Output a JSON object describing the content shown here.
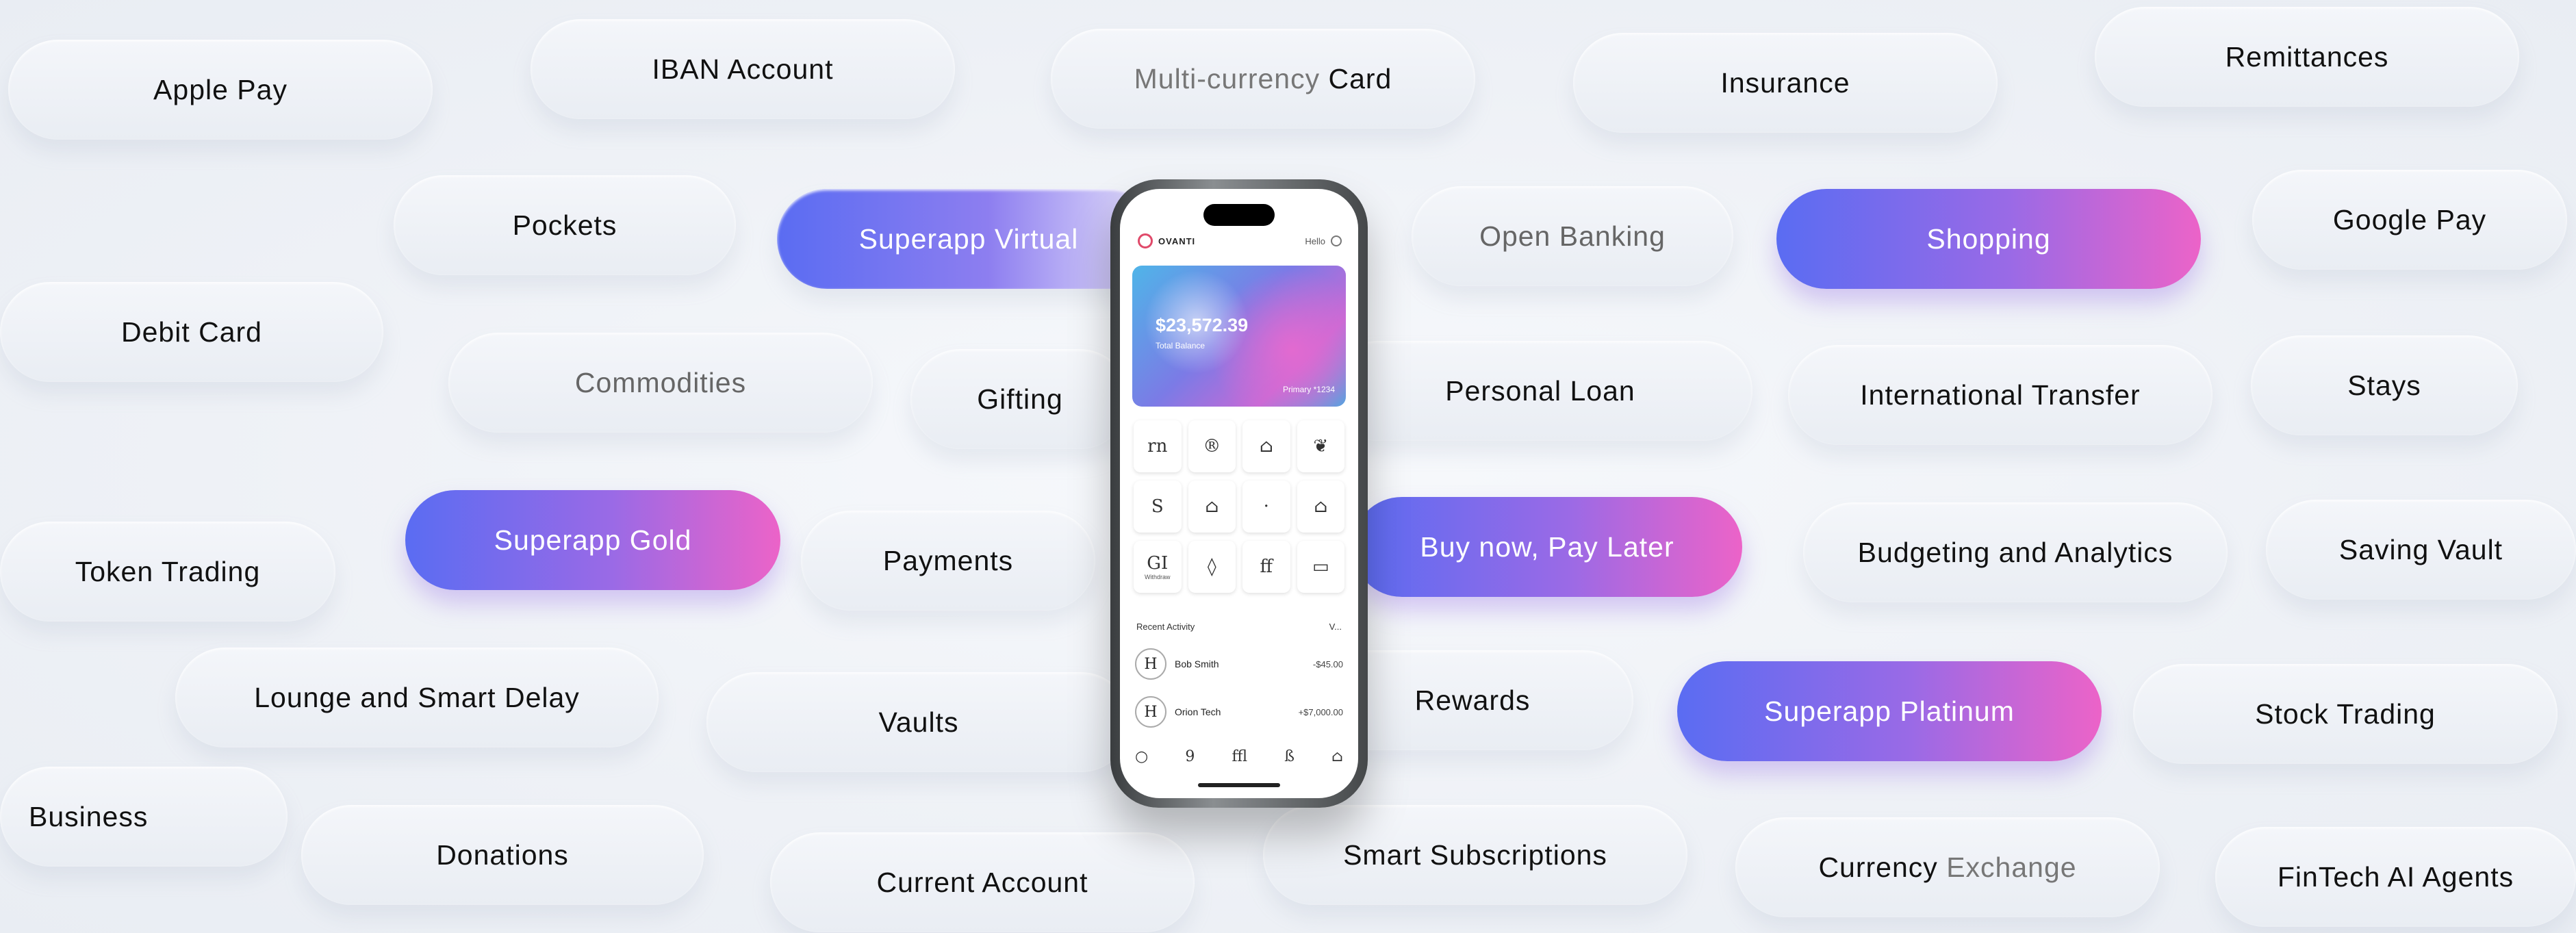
{
  "pills": [
    {
      "label": "Apple Pay"
    },
    {
      "label": "IBAN Account"
    },
    {
      "label_dim": "Multi-currency",
      "label": "Card"
    },
    {
      "label": "Insurance"
    },
    {
      "label": "Remittances"
    },
    {
      "label": "Pockets"
    },
    {
      "label": "Superapp Virtual"
    },
    {
      "label": "Open Banking"
    },
    {
      "label": "Shopping"
    },
    {
      "label": "Google Pay"
    },
    {
      "label": "Debit Card"
    },
    {
      "label": "Commodities"
    },
    {
      "label": "Gifting"
    },
    {
      "label": "Personal Loan"
    },
    {
      "label": "International Transfer"
    },
    {
      "label": "Stays"
    },
    {
      "label": "Token Trading"
    },
    {
      "label": "Superapp Gold"
    },
    {
      "label": "Payments"
    },
    {
      "label": "Buy now, Pay Later"
    },
    {
      "label": "Budgeting and Analytics"
    },
    {
      "label": "Saving Vault"
    },
    {
      "label": "Lounge and Smart Delay"
    },
    {
      "label": "Vaults"
    },
    {
      "label": "Rewards"
    },
    {
      "label": "Superapp Platinum"
    },
    {
      "label": "Stock Trading"
    },
    {
      "label": "Business"
    },
    {
      "label": "Donations"
    },
    {
      "label": "Current Account"
    },
    {
      "label": "Smart Subscriptions"
    },
    {
      "label": "Currency",
      "label_dim": "Exchange"
    },
    {
      "label": "FinTech AI Agents"
    }
  ],
  "phone": {
    "brand": "OVANTI",
    "greeting": "Hello",
    "balance": "$23,572.39",
    "balance_label": "Total Balance",
    "account": "Primary *1234",
    "tiles": [
      "rn",
      "®",
      "⌂",
      "❦",
      "S",
      "⌂",
      "·",
      "⌂",
      "GI",
      "◊",
      "ff",
      "▭"
    ],
    "withdraw_label": "Withdraw",
    "recent_title": "Recent Activity",
    "recent_link": "V...",
    "transactions": [
      {
        "initial": "H",
        "name": "Bob Smith",
        "amount": "-$45.00"
      },
      {
        "initial": "H",
        "name": "Orion Tech",
        "amount": "+$7,000.00"
      }
    ],
    "tabs": [
      "○",
      "9",
      "ffl",
      "ß",
      "⌂"
    ]
  }
}
